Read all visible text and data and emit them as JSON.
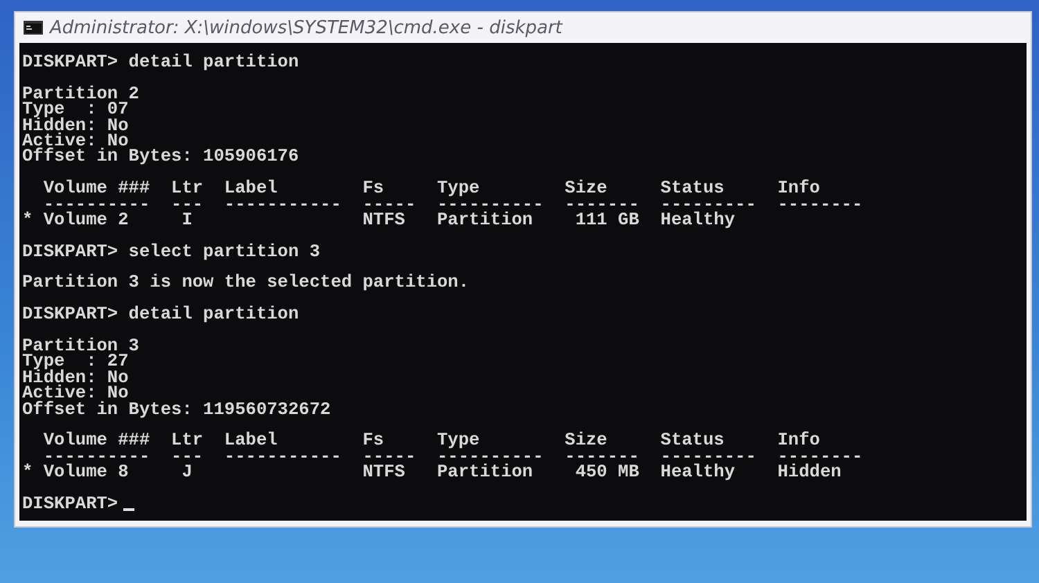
{
  "window": {
    "title": "Administrator: X:\\windows\\SYSTEM32\\cmd.exe - diskpart"
  },
  "console": {
    "lines": [
      {
        "kind": "text",
        "text": "DISKPART> detail partition"
      },
      {
        "kind": "blank"
      },
      {
        "kind": "text",
        "text": "Partition 2"
      },
      {
        "kind": "text",
        "text": "Type  : 07"
      },
      {
        "kind": "text",
        "text": "Hidden: No"
      },
      {
        "kind": "text",
        "text": "Active: No"
      },
      {
        "kind": "text",
        "text": "Offset in Bytes: 105906176"
      },
      {
        "kind": "blank"
      },
      {
        "kind": "text",
        "text": "  Volume ###  Ltr  Label        Fs     Type        Size     Status     Info"
      },
      {
        "kind": "text",
        "text": "  ----------  ---  -----------  -----  ----------  -------  ---------  --------"
      },
      {
        "kind": "text",
        "text": "* Volume 2     I                NTFS   Partition    111 GB  Healthy"
      },
      {
        "kind": "blank"
      },
      {
        "kind": "text",
        "text": "DISKPART> select partition 3"
      },
      {
        "kind": "blank"
      },
      {
        "kind": "text",
        "text": "Partition 3 is now the selected partition."
      },
      {
        "kind": "blank"
      },
      {
        "kind": "text",
        "text": "DISKPART> detail partition"
      },
      {
        "kind": "blank"
      },
      {
        "kind": "text",
        "text": "Partition 3"
      },
      {
        "kind": "text",
        "text": "Type  : 27"
      },
      {
        "kind": "text",
        "text": "Hidden: No"
      },
      {
        "kind": "text",
        "text": "Active: No"
      },
      {
        "kind": "text",
        "text": "Offset in Bytes: 119560732672"
      },
      {
        "kind": "blank"
      },
      {
        "kind": "text",
        "text": "  Volume ###  Ltr  Label        Fs     Type        Size     Status     Info"
      },
      {
        "kind": "text",
        "text": "  ----------  ---  -----------  -----  ----------  -------  ---------  --------"
      },
      {
        "kind": "text",
        "text": "* Volume 8     J                NTFS   Partition    450 MB  Healthy    Hidden"
      },
      {
        "kind": "blank"
      },
      {
        "kind": "prompt",
        "text": "DISKPART>",
        "cursor": true
      }
    ]
  }
}
